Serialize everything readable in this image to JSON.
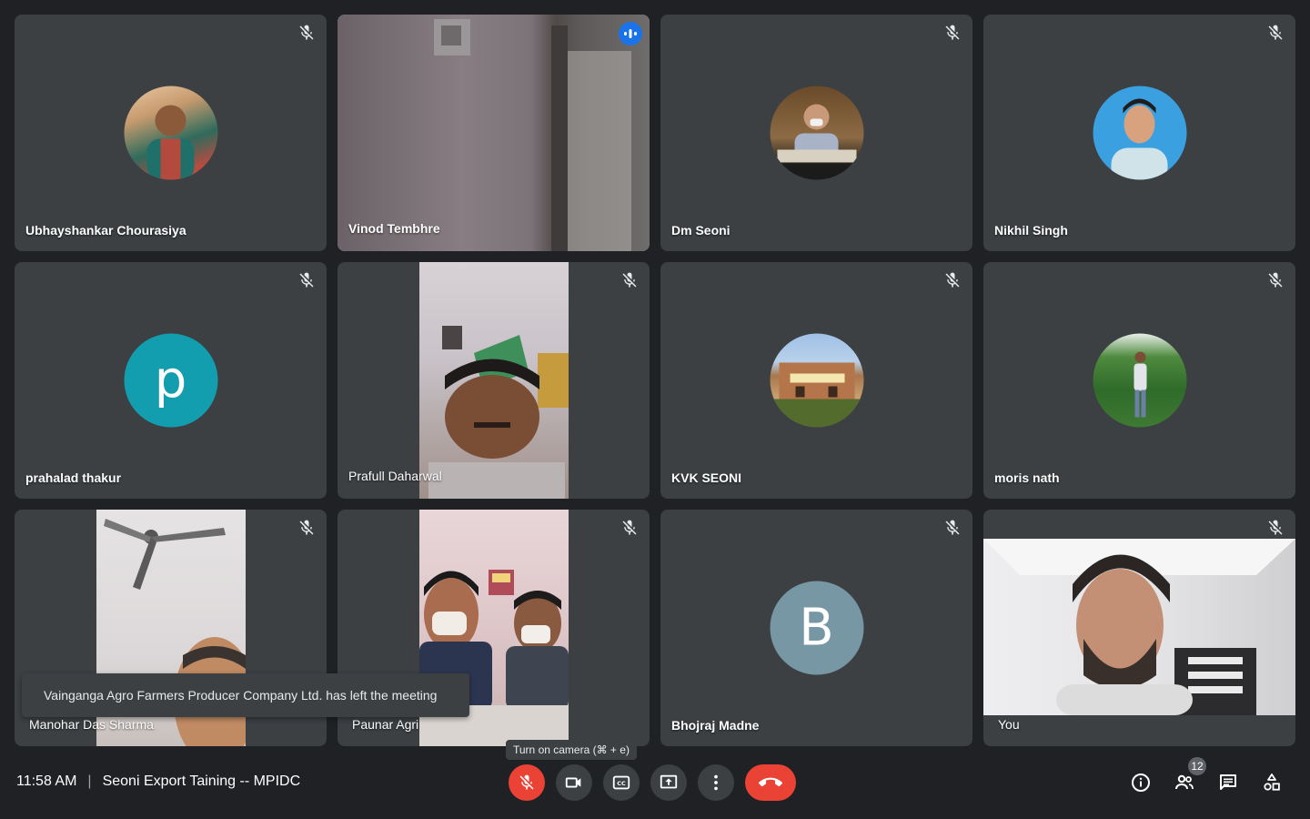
{
  "meeting": {
    "time": "11:58 AM",
    "separator": "|",
    "title": "Seoni Export Taining -- MPIDC"
  },
  "participants": [
    {
      "name": "Ubhayshankar Chourasiya",
      "muted": true,
      "tile": "avatar-photo"
    },
    {
      "name": "Vinod Tembhre",
      "muted": false,
      "speaking": true,
      "tile": "video"
    },
    {
      "name": "Dm Seoni",
      "muted": true,
      "tile": "avatar-photo"
    },
    {
      "name": "Nikhil Singh",
      "muted": true,
      "tile": "avatar-photo"
    },
    {
      "name": "prahalad thakur",
      "muted": true,
      "tile": "avatar-letter",
      "initial": "p",
      "color": "#129eaf"
    },
    {
      "name": "Prafull Daharwal",
      "muted": true,
      "tile": "video"
    },
    {
      "name": "KVK SEONI",
      "muted": true,
      "tile": "avatar-photo"
    },
    {
      "name": "moris nath",
      "muted": true,
      "tile": "avatar-photo"
    },
    {
      "name": "Manohar Das Sharma",
      "muted": true,
      "tile": "video"
    },
    {
      "name": "Paunar Agri",
      "muted": true,
      "tile": "video"
    },
    {
      "name": "Bhojraj Madne",
      "muted": true,
      "tile": "avatar-letter",
      "initial": "B",
      "color": "#7797a5"
    },
    {
      "name": "You",
      "muted": true,
      "tile": "video"
    }
  ],
  "toast": "Vainganga Agro Farmers Producer Company Ltd. has left the meeting",
  "tooltip": "Turn on camera (⌘ + e)",
  "controls": {
    "mic": {
      "icon": "mic-off-icon",
      "state": "off"
    },
    "camera": {
      "icon": "camera-icon"
    },
    "captions": {
      "icon": "captions-icon"
    },
    "present": {
      "icon": "present-icon"
    },
    "more": {
      "icon": "more-vert-icon"
    },
    "hangup": {
      "icon": "hangup-icon"
    }
  },
  "side": {
    "participants_count": "12"
  },
  "colors": {
    "background": "#202124",
    "tile": "#3c4043",
    "accent": "#8ab4f8",
    "danger": "#ea4335"
  }
}
